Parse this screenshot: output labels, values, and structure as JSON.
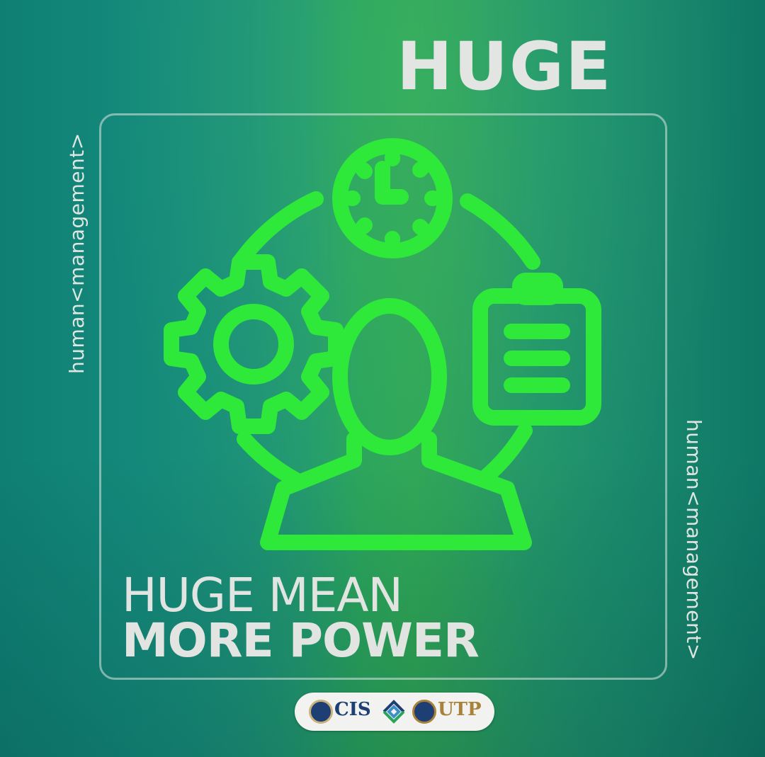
{
  "title": "HUGE",
  "side_text_left": "human<management>",
  "side_text_right": "human<management>",
  "headline_line1": "HUGE MEAN",
  "headline_line2": "MORE POWER",
  "logos": {
    "cis": "CIS",
    "utp": "UTP"
  },
  "colors": {
    "icon_green": "#2ee83a",
    "text_light": "#e2e4e2",
    "cis_blue": "#1d3f73",
    "utp_gold": "#a8823a"
  },
  "icons": [
    "clock-icon",
    "gear-icon",
    "clipboard-icon",
    "person-icon",
    "cycle-arc-icon"
  ]
}
